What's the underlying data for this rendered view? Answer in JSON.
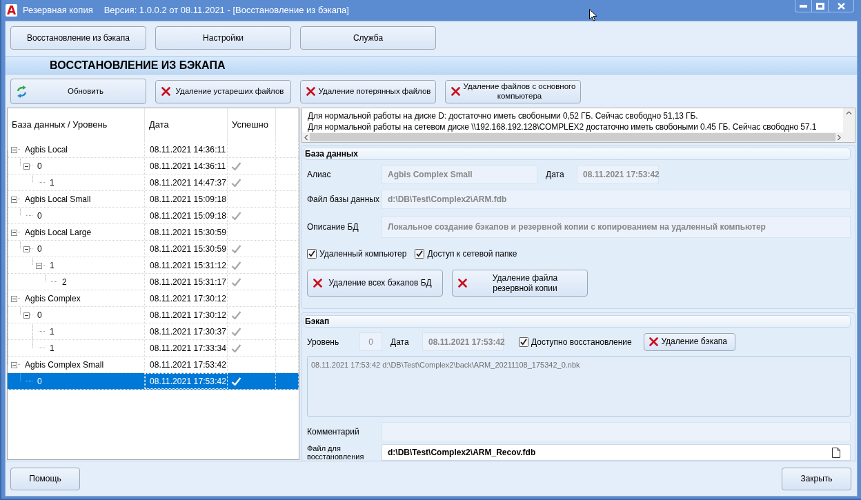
{
  "window": {
    "logo": "A",
    "title": "Резервная копия",
    "subtitle": "Версия: 1.0.0.2 от 08.11.2021 - [Восстановление из бэкапа]"
  },
  "nav_buttons": [
    {
      "label": "Восстановление из бэкапа"
    },
    {
      "label": "Настройки"
    },
    {
      "label": "Служба"
    }
  ],
  "section_title": "ВОССТАНОВЛЕНИЕ ИЗ БЭКАПА",
  "toolbar": [
    {
      "kind": "refresh",
      "label": "Обновить"
    },
    {
      "kind": "delete",
      "label": "Удаление устареших файлов"
    },
    {
      "kind": "delete",
      "label": "Удаление потерянных файлов"
    },
    {
      "kind": "delete",
      "label": "Удаление файлов с основного компьютера"
    }
  ],
  "tree": {
    "columns": [
      "База данных / Уровень",
      "Дата",
      "Успешно"
    ],
    "rows": [
      {
        "name": "Agbis Local",
        "date": "08.11.2021 14:36:11",
        "expanded": true,
        "selected": false,
        "children": [
          {
            "name": "0",
            "date": "08.11.2021 14:36:11",
            "success": true,
            "expanded": true,
            "selected": false,
            "children": [
              {
                "name": "1",
                "date": "08.11.2021 14:47:37",
                "success": true,
                "selected": false
              }
            ]
          }
        ]
      },
      {
        "name": "Agbis Local Small",
        "date": "08.11.2021 15:09:18",
        "expanded": true,
        "selected": false,
        "children": [
          {
            "name": "0",
            "date": "08.11.2021 15:09:18",
            "success": true,
            "selected": false
          }
        ]
      },
      {
        "name": "Agbis Local Large",
        "date": "08.11.2021 15:30:59",
        "expanded": true,
        "selected": false,
        "children": [
          {
            "name": "0",
            "date": "08.11.2021 15:30:59",
            "success": true,
            "expanded": true,
            "selected": false,
            "children": [
              {
                "name": "1",
                "date": "08.11.2021 15:31:12",
                "success": true,
                "expanded": true,
                "selected": false,
                "children": [
                  {
                    "name": "2",
                    "date": "08.11.2021 15:31:17",
                    "success": true,
                    "selected": false
                  }
                ]
              }
            ]
          }
        ]
      },
      {
        "name": "Agbis Complex",
        "date": "08.11.2021 17:30:12",
        "expanded": true,
        "selected": false,
        "children": [
          {
            "name": "0",
            "date": "08.11.2021 17:30:12",
            "success": true,
            "expanded": true,
            "selected": false,
            "children": [
              {
                "name": "1",
                "date": "08.11.2021 17:30:37",
                "success": true,
                "selected": false
              },
              {
                "name": "1",
                "date": "08.11.2021 17:33:34",
                "success": true,
                "selected": false
              }
            ]
          }
        ]
      },
      {
        "name": "Agbis Complex Small",
        "date": "08.11.2021 17:53:42",
        "expanded": true,
        "selected": false,
        "children": [
          {
            "name": "0",
            "date": "08.11.2021 17:53:42",
            "success": true,
            "selected": true
          }
        ]
      }
    ]
  },
  "messages": [
    "Для нормальной работы на диске D: достаточно иметь свобоными 0,52 ГБ. Сейчас свободно 51,13 ГБ.",
    "Для нормальной работы на сетевом диске \\\\192.168.192.128\\COMPLEX2 достаточно иметь свобоными 0.45 ГБ. Сейчас свободно 57.1"
  ],
  "database": {
    "title": "База данных",
    "alias": {
      "label": "Алиас",
      "value": "Agbis Complex Small",
      "disabled": true
    },
    "date": {
      "label": "Дата",
      "value": "08.11.2021 17:53:42",
      "disabled": true
    },
    "file": {
      "label": "Файл базы данных",
      "value": "d:\\DB\\Test\\Complex2\\ARM.fdb",
      "disabled": true
    },
    "description": {
      "label": "Описание БД",
      "value": "Локальное создание бэкапов и резервной копии с копированием на удаленный компьютер",
      "disabled": true
    },
    "checkboxes": [
      {
        "label": "Удаленный компьютер",
        "checked": true
      },
      {
        "label": "Доступ к сетевой папке",
        "checked": true
      }
    ],
    "buttons": [
      {
        "label": "Удаление всех бэкапов БД"
      },
      {
        "label": "Удаление файла резервной копии"
      }
    ]
  },
  "backup": {
    "title": "Бэкап",
    "level": {
      "label": "Уровень",
      "value": "0",
      "disabled": true
    },
    "date": {
      "label": "Дата",
      "value": "08.11.2021 17:53:42",
      "disabled": true
    },
    "restore_available": {
      "label": "Доступно восстановление",
      "checked": true
    },
    "delete_button": {
      "label": "Удаление бэкапа"
    },
    "log": [
      "08.11.2021 17:53:42 d:\\DB\\Test\\Complex2\\back\\ARM_20211108_175342_0.nbk"
    ],
    "comment": {
      "label": "Комментарий",
      "disabled": true
    },
    "restore_file": {
      "label": "Файл для восстановления",
      "value": "d:\\DB\\Test\\Complex2\\ARM_Recov.fdb",
      "disabled": false
    }
  },
  "footer": {
    "help_button": "Помощь",
    "close_button": "Закрыть"
  }
}
